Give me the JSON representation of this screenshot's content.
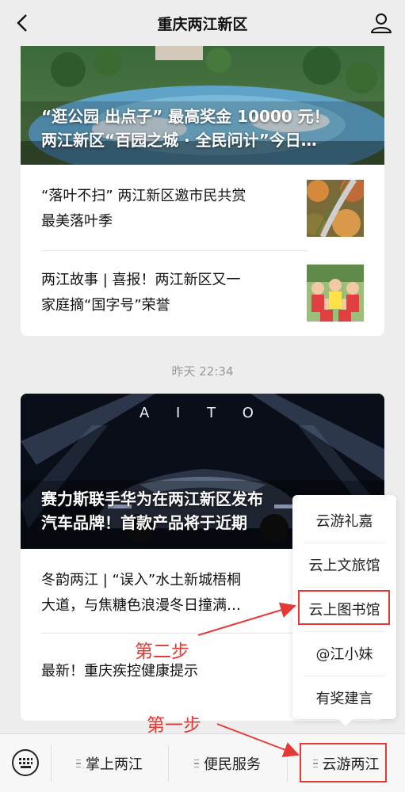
{
  "header": {
    "title": "重庆两江新区"
  },
  "feed": {
    "card1": {
      "hero_line1": "“逛公园 出点子” 最高奖金 10000 元！",
      "hero_line2": "两江新区“百园之城 · 全民问计”今日…",
      "items": [
        {
          "title_line1": "“落叶不扫” 两江新区邀市民共赏",
          "title_line2": "最美落叶季",
          "thumb_icon": "autumn-road-photo"
        },
        {
          "title_line1": "两江故事 | 喜报！两江新区又一",
          "title_line2": "家庭摘“国字号”荣誉",
          "thumb_icon": "family-group-photo"
        }
      ]
    },
    "timestamp": "昨天 22:34",
    "card2": {
      "brand_text": "A I T O",
      "hero_line1": "赛力斯联手华为在两江新区发布",
      "hero_line2": "汽车品牌！首款产品将于近期",
      "items": [
        {
          "title_line1": "冬韵两江 | “误入”水土新城梧桐",
          "title_line2": "大道，与焦糖色浪漫冬日撞满…"
        },
        {
          "title_line1": "最新！重庆疾控健康提示",
          "title_line2": ""
        }
      ]
    }
  },
  "popup_menu": {
    "items": [
      "云游礼嘉",
      "云上文旅馆",
      "云上图书馆",
      "@江小妹",
      "有奖建言"
    ],
    "highlighted_index": 2
  },
  "bottom_bar": {
    "tabs": [
      "掌上两江",
      "便民服务",
      "云游两江"
    ]
  },
  "annotations": {
    "step1": "第一步",
    "step2": "第二步",
    "color": "#e53935"
  }
}
